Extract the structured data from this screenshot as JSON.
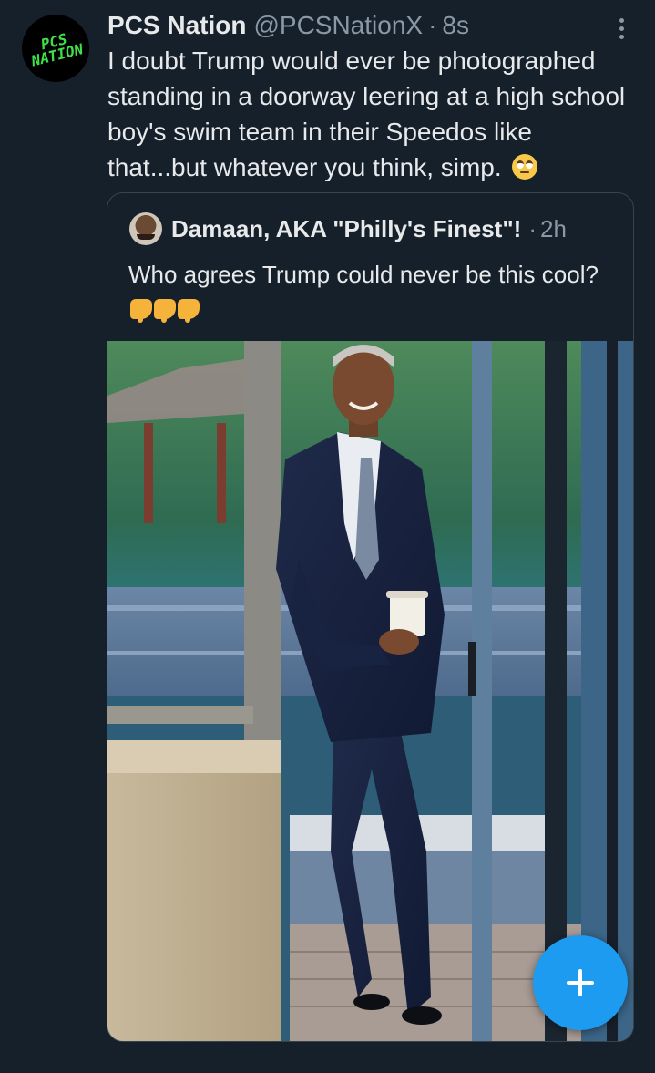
{
  "tweet": {
    "display_name": "PCS Nation",
    "handle": "@PCSNationX",
    "separator": "·",
    "time": "8s",
    "avatar_text": "PCS NATION",
    "text": "I doubt Trump would ever be photographed standing in a doorway leering at a high school boy's swim team in their Speedos like that...but whatever you think, simp.",
    "emoji": "face-with-rolling-eyes-icon"
  },
  "quote": {
    "display_name": "Damaan, AKA \"Philly's Finest\"!",
    "separator": "·",
    "time": "2h",
    "text": "Who agrees Trump could never be this cool?",
    "emoji": "backhand-index-pointing-down-icon x3",
    "image_description_icon": "photo-icon"
  },
  "fab": {
    "icon": "plus-icon",
    "color": "#1d9bf0"
  },
  "colors": {
    "background": "#15202b",
    "primary_text": "#e7e9ea",
    "secondary_text": "#8b98a5",
    "border": "#38444d",
    "accent": "#1d9bf0"
  }
}
